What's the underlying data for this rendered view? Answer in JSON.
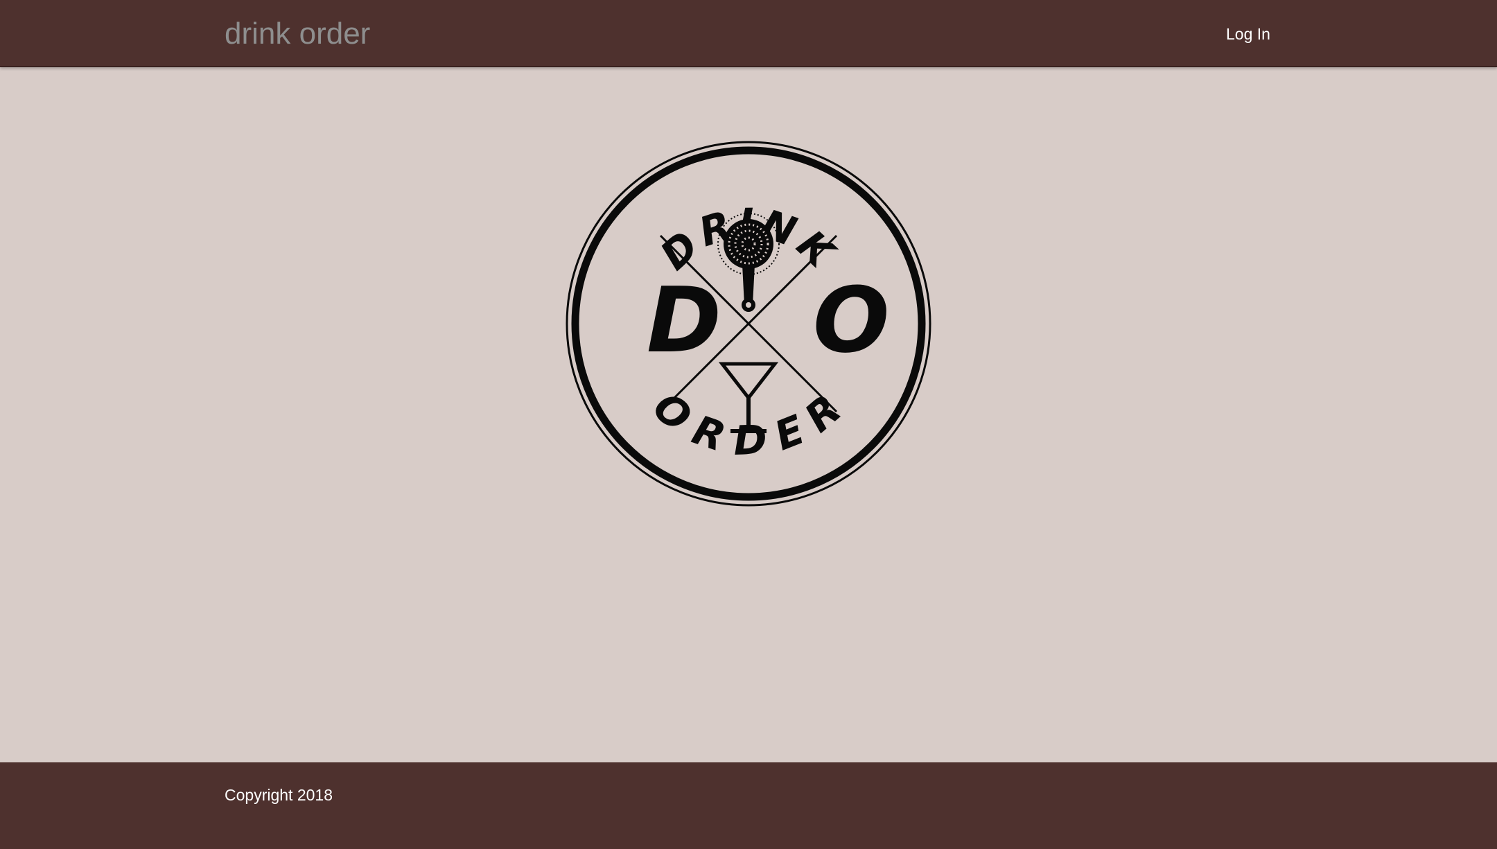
{
  "header": {
    "brand": "drink order",
    "login_label": "Log In"
  },
  "logo": {
    "top_text": "DRINK",
    "bottom_text": "ORDER",
    "left_letter": "D",
    "right_letter": "O",
    "icons": [
      "strainer-icon",
      "martini-glass-icon"
    ]
  },
  "footer": {
    "copyright": "Copyright 2018"
  },
  "colors": {
    "nav_bg": "#4e312e",
    "page_bg": "#d8ccc8",
    "brand_text": "#8e8e8e",
    "logo_ink": "#0a0a0a"
  }
}
